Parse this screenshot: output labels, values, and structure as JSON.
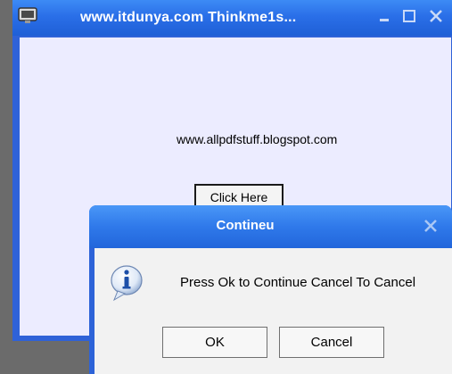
{
  "main_window": {
    "title": "www.itdunya.com  Thinkme1s...",
    "url_text": "www.allpdfstuff.blogspot.com",
    "click_button_label": "Click Here"
  },
  "dialog": {
    "title": "Contineu",
    "message": "Press Ok to Continue Cancel To Cancel",
    "ok_label": "OK",
    "cancel_label": "Cancel"
  },
  "icons": {
    "app": "monitor-icon",
    "minimize": "minimize-icon",
    "maximize": "maximize-icon",
    "close": "close-icon",
    "info": "info-icon"
  },
  "colors": {
    "titlebar": "#2a6fe8",
    "client_bg": "#ececff",
    "dialog_body": "#f2f2f2"
  }
}
